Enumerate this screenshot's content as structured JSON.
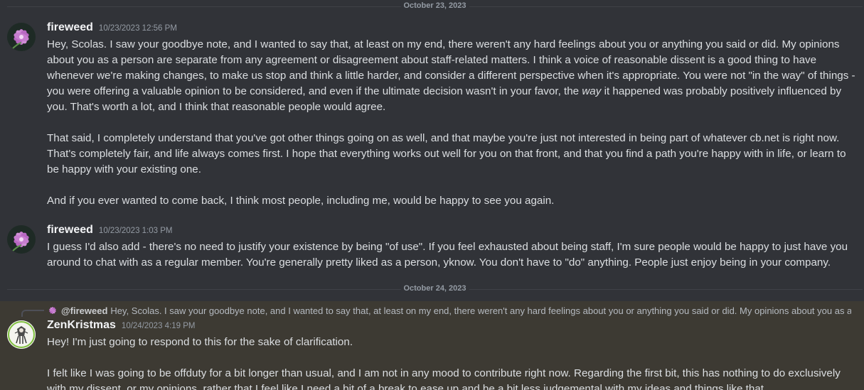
{
  "dividers": [
    {
      "label": "October 23, 2023"
    },
    {
      "label": "October 24, 2023"
    }
  ],
  "messages": [
    {
      "username": "fireweed",
      "timestamp": "10/23/2023 12:56 PM",
      "paragraphs": [
        {
          "before": "Hey, Scolas. I saw your goodbye note, and I wanted to say that, at least on my end, there weren't any hard feelings about you or anything you said or did. My opinions about you as a person are separate from any agreement or disagreement about staff-related matters. I think a voice of reasonable dissent is a good thing to have whenever we're making changes, to make us stop and think a little harder, and consider a different perspective when it's appropriate. You were not \"in the way\" of things - you were offering a valuable opinion to be considered, and even if the ultimate decision wasn't in your favor, the ",
          "emphasis": "way",
          "after": " it happened was probably positively influenced by you. That's worth a lot, and I think that reasonable people would agree."
        },
        {
          "text": "That said, I completely understand that you've got other things going on as well, and that maybe you're just not interested in being part of whatever cb.net is right now. That's completely fair, and life always comes first. I hope that everything works out well for you on that front, and that you find a path you're happy with in life, or learn to be happy with your existing one."
        },
        {
          "text": "And if you ever wanted to come back, I think most people, including me, would be happy to see you again."
        }
      ]
    },
    {
      "username": "fireweed",
      "timestamp": "10/23/2023 1:03 PM",
      "text": "I guess I'd also add - there's no need to justify your existence by being \"of use\". If you feel exhausted about being staff, I'm sure people would be happy to just have you around to chat with as a regular member. You're generally pretty liked as a person, yknow. You don't have to \"do\" anything. People just enjoy being in your company."
    },
    {
      "reply": {
        "mention": "@fireweed",
        "preview": "Hey, Scolas. I saw your goodbye note, and I wanted to say that, at least on my end, there weren't any hard feelings about you or anything you said or did. My opinions about you as a"
      },
      "username": "ZenKristmas",
      "timestamp": "10/24/2023 4:19 PM",
      "paragraphs": [
        "Hey! I'm just going to respond to this for the sake of clarification.",
        "I felt like I was going to be offduty for a bit longer than usual, and I am not in any mood to contribute right now. Regarding the first bit, this has nothing to do exclusively with my dissent, or my opinions, rather that I feel like I need a bit of a break to ease up and be a bit less judgemental with my ideas and things like that."
      ]
    }
  ],
  "colors": {
    "background": "#313338",
    "highlight_background": "#3d3a33",
    "text": "#dbdee1",
    "username": "#f2f3f5",
    "muted": "#949ba4"
  },
  "icons": {
    "fireweed_avatar": "pink-flower-avatar-icon",
    "zenkristmas_avatar": "sketch-figure-avatar-icon"
  }
}
